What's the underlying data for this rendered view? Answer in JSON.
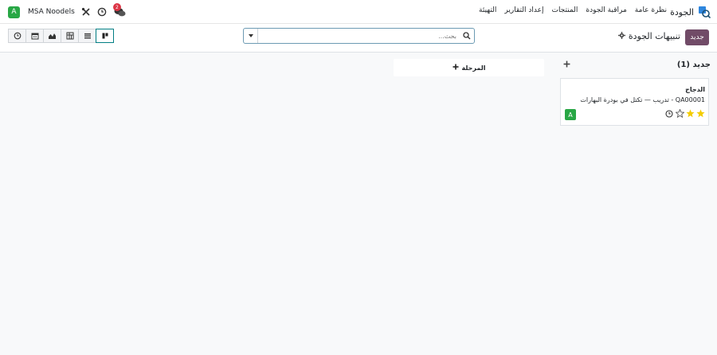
{
  "navbar": {
    "app_title": "الجودة",
    "menu": [
      "نظرة عامة",
      "مراقبة الجودة",
      "المنتجات",
      "إعداد التقارير",
      "التهيئة"
    ],
    "systray": {
      "avatar_letter": "A",
      "company": "MSA Noodels",
      "chat_badge": "2"
    }
  },
  "control": {
    "new_label": "جديد",
    "title": "تنبيهات الجودة",
    "search_placeholder": "بحث...",
    "views": [
      "activity",
      "calendar",
      "graph",
      "pivot",
      "list",
      "kanban"
    ],
    "active_view": "kanban"
  },
  "kanban": {
    "column_title": "جديد (1)",
    "add_stage_label": "المرحلة",
    "card": {
      "title": "الدجاج",
      "description": "QA00001 - تدريب — تكتل في بودرة البهارات",
      "stars": 2,
      "max_stars": 3,
      "assignee_letter": "A"
    }
  },
  "colors": {
    "primary": "#714b67",
    "accent": "#017e84",
    "star": "#f3cc00",
    "avatar": "#28a745",
    "badge": "#dc3545"
  }
}
